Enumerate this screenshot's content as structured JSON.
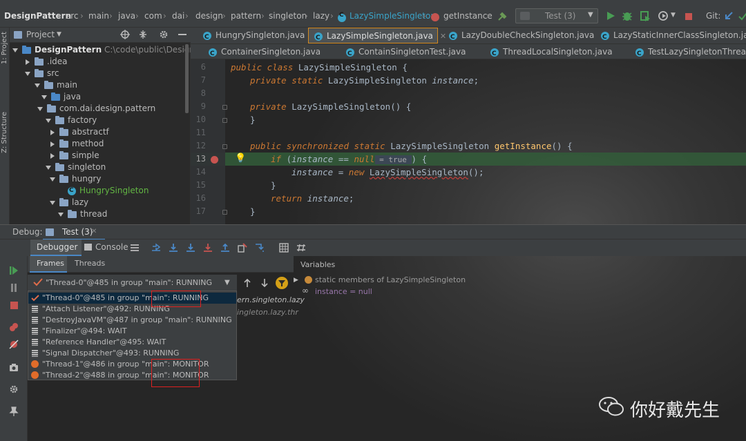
{
  "navbar": {
    "crumbs": [
      "DesignPattern",
      "src",
      "main",
      "java",
      "com",
      "dai",
      "design",
      "pattern",
      "singleton",
      "lazy",
      "LazySimpleSingleton",
      "getInstance"
    ],
    "run_config": "Test (3)",
    "git_label": "Git:"
  },
  "left_stripe": {
    "project": "1: Project",
    "structure": "Z: Structure"
  },
  "project": {
    "header": "Project",
    "tree": [
      {
        "label": "DesignPattern",
        "extra": "C:\\code\\public\\DesignPatte"
      },
      {
        "label": ".idea"
      },
      {
        "label": "src"
      },
      {
        "label": "main"
      },
      {
        "label": "java"
      },
      {
        "label": "com.dai.design.pattern"
      },
      {
        "label": "factory"
      },
      {
        "label": "abstractf"
      },
      {
        "label": "method"
      },
      {
        "label": "simple"
      },
      {
        "label": "singleton"
      },
      {
        "label": "hungry"
      },
      {
        "label": "HungrySingleton"
      },
      {
        "label": "lazy"
      },
      {
        "label": "thread"
      }
    ]
  },
  "tabs_row1": [
    "HungrySingleton.java",
    "LazySimpleSingleton.java",
    "LazyDoubleCheckSingleton.java",
    "LazyStaticInnerClassSingleton.java"
  ],
  "tabs_row2": [
    "ContainerSingleton.java",
    "ContainSingletonTest.java",
    "ThreadLocalSingleton.java",
    "TestLazySingletonThread.java"
  ],
  "editor": {
    "line_numbers": [
      "6",
      "7",
      "8",
      "9",
      "10",
      "11",
      "12",
      "13",
      "14",
      "15",
      "16",
      "17"
    ],
    "l6": {
      "kw": "public class ",
      "name": "LazySimpleSingleton",
      "tail": " {"
    },
    "l7": {
      "kw": "private static ",
      "type": "LazySimpleSingleton ",
      "field": "instance",
      "tail": ";"
    },
    "l9": {
      "kw": "private ",
      "name": "LazySimpleSingleton",
      "tail": "() {"
    },
    "l10": "}",
    "l12": {
      "kw": "public synchronized static ",
      "type": "LazySimpleSingleton ",
      "name": "getInstance",
      "tail": "() {"
    },
    "l13": {
      "kw": "if ",
      "open": "(",
      "var": "instance",
      "op": " == ",
      "null": "null",
      "hint": " = true ",
      "tail": ") {"
    },
    "l14": {
      "var": "instance",
      "op": " = ",
      "kw": "new ",
      "name": "LazySimpleSingleton",
      "tail": "();"
    },
    "l15": "}",
    "l16": {
      "kw": "return ",
      "var": "instance",
      "tail": ";"
    },
    "l17": "}"
  },
  "debug": {
    "label": "Debug:",
    "session": "Test (3)",
    "tab_debugger": "Debugger",
    "tab_console": "Console",
    "frames_tab": "Frames",
    "threads_tab": "Threads",
    "variables_title": "Variables",
    "selected_thread": "\"Thread-0\"@485 in group \"main\": RUNNING",
    "threads": [
      {
        "name": "\"Thread-0\"@485 in group \"main\"",
        "status": ": RUNNING",
        "icon": "check"
      },
      {
        "name": "\"Attach Listener\"@492: RUNNING",
        "status": "",
        "icon": "stack"
      },
      {
        "name": "\"DestroyJavaVM\"@487 in group \"main\": RUNNING",
        "status": "",
        "icon": "stack"
      },
      {
        "name": "\"Finalizer\"@494: WAIT",
        "status": "",
        "icon": "stack"
      },
      {
        "name": "\"Reference Handler\"@495: WAIT",
        "status": "",
        "icon": "stack"
      },
      {
        "name": "\"Signal Dispatcher\"@493: RUNNING",
        "status": "",
        "icon": "stack"
      },
      {
        "name": "\"Thread-1\"@486 in group \"main\"",
        "status": ": MONITOR",
        "icon": "orange-dot"
      },
      {
        "name": "\"Thread-2\"@488 in group \"main\"",
        "status": ": MONITOR",
        "icon": "orange-dot"
      }
    ],
    "frame_peek_1": "ern.singleton.lazy",
    "frame_peek_2": "ingleton.lazy.thr",
    "variables": [
      {
        "label": "static members of LazySimpleSingleton"
      },
      {
        "label": "instance = null"
      }
    ]
  },
  "watermark": {
    "text": "你好戴先生"
  },
  "colors": {
    "accent": "#4a88c7",
    "breakpoint": "#c75450",
    "highlight_line": "#32593d",
    "selection_box": "#e02020"
  }
}
